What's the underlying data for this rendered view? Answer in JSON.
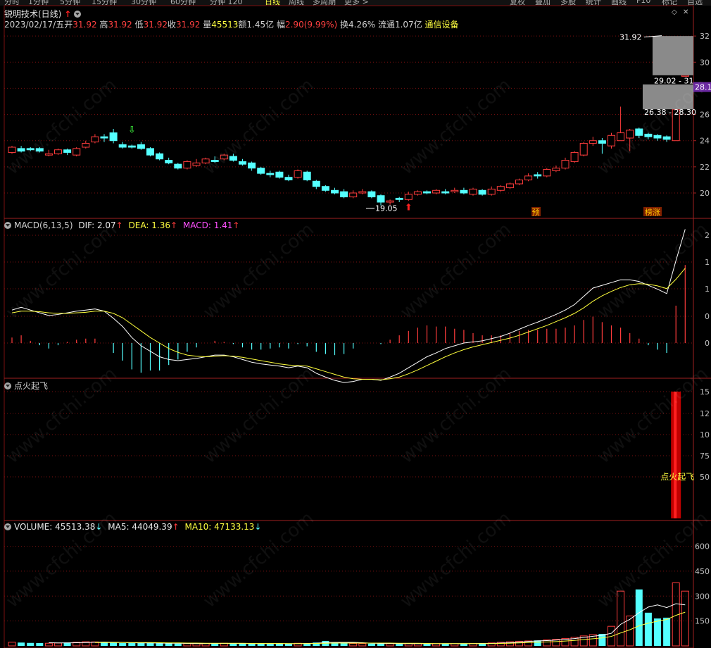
{
  "toolbar": {
    "left": [
      "分时",
      "1分钟",
      "5分钟",
      "15分钟",
      "30分钟",
      "60分钟",
      "分钟 120",
      "日线",
      "周线",
      "多周期",
      "更多 >"
    ],
    "right": [
      "复权",
      "叠加",
      "多股",
      "统计",
      "画线",
      "F10",
      "标记",
      "自选"
    ]
  },
  "stock": {
    "name": "锐明技术(日线)",
    "date": "2023/02/17/五",
    "open_label": "开",
    "open": "31.92",
    "high_label": "高",
    "high": "31.92",
    "low_label": "低",
    "low": "31.92",
    "close_label": "收",
    "close": "31.92",
    "vol_label": "量",
    "vol": "45513",
    "amount": "额1.45亿",
    "range_label": "幅",
    "range": "2.90(9.99%)",
    "turnover": "换4.26%",
    "float": "流通1.07亿",
    "sector": "通信设备"
  },
  "price_axis": [
    "32",
    "30",
    "28",
    "26",
    "24",
    "22",
    "20"
  ],
  "price_annotations": {
    "high_label": "31.92",
    "low_label": "19.05",
    "range_box1": "29.02 - 31",
    "range_box2": "26.38 - 28.30",
    "current": "28.11",
    "tag_yu": "预",
    "tag_bang": "榜涨"
  },
  "macd": {
    "title": "MACD(6,13,5)",
    "dif": "DIF: 2.07",
    "dea": "DEA: 1.36",
    "macd": "MACD: 1.41",
    "axis": [
      "2",
      "1",
      "1",
      "0",
      "0"
    ]
  },
  "ind": {
    "title": "点火起飞",
    "label": "点火起飞",
    "axis": [
      "15",
      "12",
      "10",
      "75",
      "50"
    ]
  },
  "vol": {
    "title": "VOLUME: 45513.38",
    "ma5": "MA5: 44049.39",
    "ma10": "MA10: 47133.13",
    "axis": [
      "600",
      "450",
      "300",
      "150"
    ]
  },
  "watermark": "www.cfchi.com",
  "colors": {
    "up": "#ff3c3c",
    "down": "#54ffff",
    "dif": "#ffffff",
    "dea": "#ffff3c",
    "macd": "#ff50ff",
    "grid": "#7a1010",
    "text": "#c8c8c8"
  },
  "chart_data": {
    "type": "candlestick",
    "ylim": [
      18.6,
      32.6
    ],
    "candles": [
      [
        23.1,
        23.5,
        23.0,
        23.6
      ],
      [
        23.4,
        23.2,
        23.1,
        23.6
      ],
      [
        23.4,
        23.3,
        23.2,
        23.5
      ],
      [
        23.4,
        23.2,
        23.1,
        23.5
      ],
      [
        22.9,
        23.0,
        22.8,
        23.3
      ],
      [
        23.0,
        23.3,
        22.9,
        23.4
      ],
      [
        23.3,
        23.1,
        22.9,
        23.4
      ],
      [
        22.9,
        23.4,
        22.8,
        23.5
      ],
      [
        23.5,
        23.8,
        23.4,
        24.0
      ],
      [
        23.9,
        24.3,
        23.8,
        24.5
      ],
      [
        24.3,
        24.2,
        23.9,
        24.5
      ],
      [
        24.6,
        24.0,
        23.8,
        24.9
      ],
      [
        23.7,
        23.5,
        23.4,
        23.9
      ],
      [
        23.6,
        23.5,
        23.4,
        23.7
      ],
      [
        23.7,
        23.4,
        23.3,
        23.9
      ],
      [
        23.4,
        22.9,
        22.8,
        23.5
      ],
      [
        23.0,
        22.6,
        22.5,
        23.1
      ],
      [
        22.5,
        22.3,
        22.2,
        22.7
      ],
      [
        22.2,
        21.9,
        21.8,
        22.3
      ],
      [
        21.9,
        22.4,
        21.8,
        22.5
      ],
      [
        22.1,
        22.3,
        22.0,
        22.6
      ],
      [
        22.3,
        22.6,
        22.2,
        22.7
      ],
      [
        22.5,
        22.4,
        22.3,
        22.8
      ],
      [
        22.6,
        22.9,
        22.5,
        23.0
      ],
      [
        22.8,
        22.5,
        22.4,
        23.0
      ],
      [
        22.4,
        22.2,
        22.1,
        22.6
      ],
      [
        22.3,
        21.9,
        21.7,
        22.4
      ],
      [
        21.9,
        21.5,
        21.4,
        22.0
      ],
      [
        21.5,
        21.4,
        21.2,
        21.7
      ],
      [
        21.6,
        21.2,
        21.1,
        21.7
      ],
      [
        21.2,
        21.0,
        20.9,
        21.4
      ],
      [
        21.2,
        21.7,
        21.1,
        21.8
      ],
      [
        21.6,
        21.0,
        20.9,
        21.7
      ],
      [
        20.9,
        20.5,
        20.3,
        21.0
      ],
      [
        20.5,
        20.2,
        20.1,
        20.6
      ],
      [
        20.2,
        20.0,
        19.9,
        20.4
      ],
      [
        20.1,
        19.7,
        19.6,
        20.3
      ],
      [
        19.7,
        20.0,
        19.6,
        20.2
      ],
      [
        20.0,
        20.1,
        19.9,
        20.3
      ],
      [
        20.1,
        19.7,
        19.6,
        20.2
      ],
      [
        19.8,
        19.3,
        19.05,
        19.9
      ],
      [
        19.3,
        19.4,
        19.1,
        19.5
      ],
      [
        19.6,
        19.5,
        19.3,
        19.7
      ],
      [
        19.5,
        19.9,
        19.4,
        20.1
      ],
      [
        19.9,
        20.1,
        19.8,
        20.2
      ],
      [
        20.1,
        20.0,
        19.9,
        20.2
      ],
      [
        20.0,
        20.2,
        19.9,
        20.3
      ],
      [
        20.1,
        20.0,
        19.9,
        20.3
      ],
      [
        20.1,
        20.2,
        20.0,
        20.4
      ],
      [
        20.2,
        20.0,
        19.9,
        20.4
      ],
      [
        19.9,
        20.3,
        19.8,
        20.4
      ],
      [
        20.2,
        19.9,
        19.8,
        20.3
      ],
      [
        19.9,
        20.3,
        19.8,
        20.5
      ],
      [
        20.2,
        20.5,
        20.1,
        20.6
      ],
      [
        20.4,
        20.7,
        20.3,
        20.8
      ],
      [
        20.7,
        21.0,
        20.6,
        21.1
      ],
      [
        21.0,
        21.3,
        20.9,
        21.5
      ],
      [
        21.4,
        21.3,
        21.1,
        21.6
      ],
      [
        21.3,
        21.8,
        21.2,
        21.9
      ],
      [
        21.7,
        21.9,
        21.6,
        22.1
      ],
      [
        21.9,
        22.5,
        21.8,
        22.7
      ],
      [
        22.4,
        23.1,
        22.3,
        23.2
      ],
      [
        22.9,
        23.8,
        22.8,
        23.9
      ],
      [
        23.8,
        24.0,
        23.6,
        24.3
      ],
      [
        24.0,
        23.8,
        23.0,
        24.2
      ],
      [
        23.6,
        24.4,
        23.4,
        24.6
      ],
      [
        24.0,
        24.6,
        24.0,
        26.6
      ],
      [
        24.2,
        24.8,
        23.2,
        24.9
      ],
      [
        24.9,
        24.4,
        24.2,
        25.0
      ],
      [
        24.5,
        24.3,
        24.1,
        24.6
      ],
      [
        24.4,
        24.2,
        24.0,
        24.5
      ],
      [
        24.3,
        24.1,
        23.9,
        24.4
      ],
      [
        24.0,
        26.4,
        24.0,
        26.4
      ],
      [
        29.0,
        29.0,
        29.0,
        29.0
      ]
    ],
    "macd_dif": [
      0.6,
      0.65,
      0.6,
      0.55,
      0.5,
      0.52,
      0.55,
      0.58,
      0.6,
      0.62,
      0.58,
      0.45,
      0.3,
      0.1,
      -0.05,
      -0.15,
      -0.25,
      -0.3,
      -0.32,
      -0.3,
      -0.28,
      -0.25,
      -0.22,
      -0.22,
      -0.25,
      -0.3,
      -0.35,
      -0.38,
      -0.4,
      -0.42,
      -0.45,
      -0.42,
      -0.45,
      -0.55,
      -0.62,
      -0.68,
      -0.72,
      -0.7,
      -0.66,
      -0.66,
      -0.68,
      -0.62,
      -0.55,
      -0.45,
      -0.35,
      -0.25,
      -0.18,
      -0.1,
      -0.05,
      0.0,
      0.02,
      0.04,
      0.08,
      0.12,
      0.18,
      0.25,
      0.32,
      0.38,
      0.45,
      0.52,
      0.6,
      0.7,
      0.85,
      1.0,
      1.05,
      1.1,
      1.15,
      1.15,
      1.12,
      1.05,
      0.98,
      0.9,
      1.5,
      2.07
    ],
    "macd_dea": [
      0.55,
      0.58,
      0.58,
      0.57,
      0.55,
      0.54,
      0.54,
      0.55,
      0.56,
      0.58,
      0.58,
      0.54,
      0.46,
      0.34,
      0.22,
      0.1,
      -0.0,
      -0.1,
      -0.17,
      -0.22,
      -0.24,
      -0.25,
      -0.24,
      -0.23,
      -0.24,
      -0.26,
      -0.29,
      -0.32,
      -0.35,
      -0.38,
      -0.4,
      -0.41,
      -0.42,
      -0.47,
      -0.52,
      -0.57,
      -0.62,
      -0.65,
      -0.66,
      -0.66,
      -0.67,
      -0.65,
      -0.62,
      -0.56,
      -0.49,
      -0.41,
      -0.33,
      -0.25,
      -0.18,
      -0.12,
      -0.07,
      -0.03,
      0.01,
      0.05,
      0.09,
      0.14,
      0.2,
      0.26,
      0.32,
      0.39,
      0.46,
      0.54,
      0.64,
      0.76,
      0.86,
      0.94,
      1.01,
      1.06,
      1.08,
      1.07,
      1.04,
      0.99,
      1.16,
      1.36
    ],
    "indicator": {
      "bar_index": 72,
      "value": 150
    },
    "volume": [
      22,
      20,
      18,
      17,
      16,
      17,
      20,
      22,
      25,
      24,
      21,
      19,
      17,
      18,
      18,
      17,
      16,
      15,
      14,
      14,
      14,
      15,
      15,
      16,
      16,
      14,
      14,
      13,
      12,
      13,
      14,
      16,
      17,
      20,
      30,
      22,
      16,
      15,
      14,
      14,
      18,
      13,
      12,
      13,
      13,
      14,
      14,
      13,
      13,
      14,
      15,
      16,
      18,
      22,
      25,
      28,
      30,
      33,
      36,
      40,
      45,
      52,
      60,
      68,
      72,
      118,
      330,
      180,
      340,
      200,
      165,
      170,
      380,
      330
    ],
    "volume_ylim": [
      0,
      700
    ],
    "ma5": [
      0,
      0,
      0,
      0,
      19,
      18,
      18,
      19,
      20,
      22,
      23,
      22,
      21,
      19,
      18,
      18,
      17,
      16,
      16,
      15,
      14,
      14,
      15,
      15,
      15,
      15,
      14,
      14,
      14,
      14,
      13,
      14,
      15,
      16,
      20,
      21,
      21,
      21,
      19,
      16,
      15,
      15,
      14,
      14,
      13,
      13,
      13,
      14,
      14,
      14,
      14,
      15,
      15,
      17,
      19,
      23,
      27,
      30,
      32,
      35,
      39,
      44,
      51,
      58,
      64,
      76,
      130,
      160,
      200,
      234,
      247,
      231,
      254,
      247
    ],
    "ma10": [
      0,
      0,
      0,
      0,
      0,
      0,
      0,
      0,
      0,
      20,
      20,
      20,
      20,
      20,
      20,
      20,
      19,
      18,
      18,
      17,
      17,
      16,
      16,
      16,
      16,
      16,
      15,
      15,
      15,
      15,
      14,
      14,
      14,
      15,
      16,
      17,
      17,
      17,
      17,
      17,
      17,
      17,
      16,
      16,
      16,
      15,
      14,
      14,
      14,
      14,
      14,
      14,
      14,
      15,
      16,
      18,
      20,
      22,
      24,
      26,
      29,
      33,
      38,
      43,
      48,
      57,
      78,
      97,
      121,
      137,
      149,
      159,
      184,
      203
    ]
  }
}
